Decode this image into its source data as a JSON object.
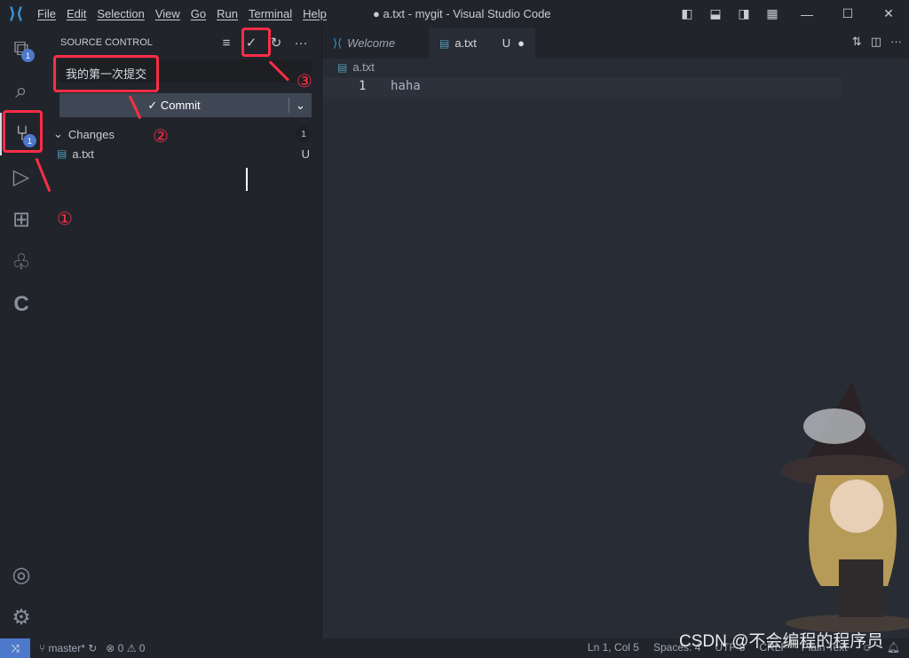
{
  "titlebar": {
    "menu": [
      "File",
      "Edit",
      "Selection",
      "View",
      "Go",
      "Run",
      "Terminal",
      "Help"
    ],
    "title": "● a.txt - mygit - Visual Studio Code"
  },
  "activity": {
    "explorer_badge": "1",
    "scm_badge": "1"
  },
  "sidebar": {
    "title": "SOURCE CONTROL",
    "message": "我的第一次提交",
    "commit_label": "✓ Commit",
    "changes_label": "Changes",
    "changes_count": "1",
    "files": [
      {
        "name": "a.txt",
        "status": "U"
      }
    ]
  },
  "tabs": [
    {
      "label": "Welcome"
    },
    {
      "label": "a.txt",
      "status": "U"
    }
  ],
  "editor": {
    "breadcrumb": "a.txt",
    "lines": [
      {
        "num": "1",
        "text": "haha"
      }
    ]
  },
  "status": {
    "branch": "master*",
    "errors": "0",
    "warnings": "0",
    "position": "Ln 1, Col 5",
    "spaces": "Spaces: 4",
    "encoding": "UTF-8",
    "eol": "CRLF",
    "language": "Plain Text"
  },
  "annotations": {
    "n1": "①",
    "n2": "②",
    "n3": "③",
    "color": "#ff2d46"
  },
  "watermark": "CSDN @不会编程的程序员"
}
